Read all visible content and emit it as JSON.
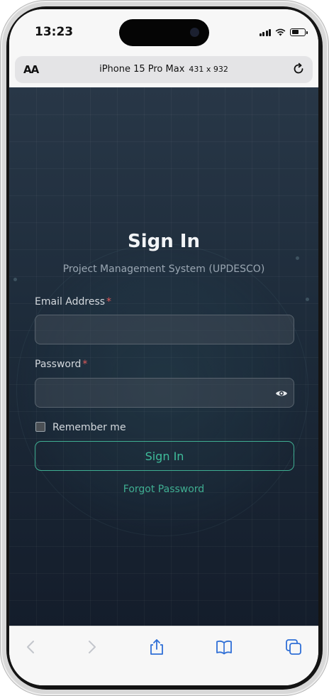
{
  "status_bar": {
    "time": "13:23"
  },
  "browser": {
    "text_size_button": "AA",
    "device_name": "iPhone 15 Pro Max",
    "device_dims": "431 x 932"
  },
  "login": {
    "title": "Sign In",
    "subtitle": "Project Management System (UPDESCO)",
    "email_label": "Email Address",
    "email_value": "",
    "password_label": "Password",
    "password_value": "",
    "required_marker": "*",
    "remember_label": "Remember me",
    "remember_checked": false,
    "submit_label": "Sign In",
    "forgot_label": "Forgot Password"
  },
  "toolbar": {
    "icons": [
      "back-icon",
      "forward-icon",
      "share-icon",
      "bookmarks-icon",
      "tabs-icon"
    ]
  },
  "colors": {
    "accent": "#3fae92",
    "required": "#e05a5a",
    "background_top": "#283747",
    "background_bottom": "#141d2b"
  }
}
